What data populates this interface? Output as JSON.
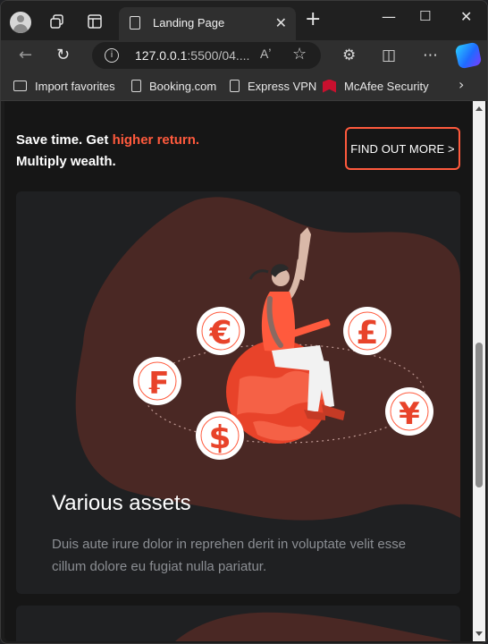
{
  "browser": {
    "tab_title": "Landing Page",
    "url_host": "127.0.0.1",
    "url_rest": ":5500/04....",
    "read_aloud": "Aʼ",
    "favorites": [
      {
        "label": "Import favorites",
        "icon": "folder-icon"
      },
      {
        "label": "Booking.com",
        "icon": "page-icon"
      },
      {
        "label": "Express VPN",
        "icon": "page-icon"
      },
      {
        "label": "McAfee Security",
        "icon": "mcafee-icon"
      }
    ]
  },
  "promo": {
    "line1_prefix": "Save time. Get ",
    "line1_accent": "higher return.",
    "line2": "Multiply wealth.",
    "cta_label": "FIND OUT MORE >"
  },
  "card": {
    "title": "Various assets",
    "text": "Duis aute irure dolor in reprehen derit in voluptate velit esse cillum dolore eu fugiat nulla pariatur.",
    "currency_symbols": [
      "€",
      "£",
      "₣",
      "¥",
      "$"
    ]
  },
  "colors": {
    "accent": "#ff5a3d",
    "blob": "#4a2824",
    "card_bg": "#1f2022",
    "page_bg": "#161616"
  }
}
